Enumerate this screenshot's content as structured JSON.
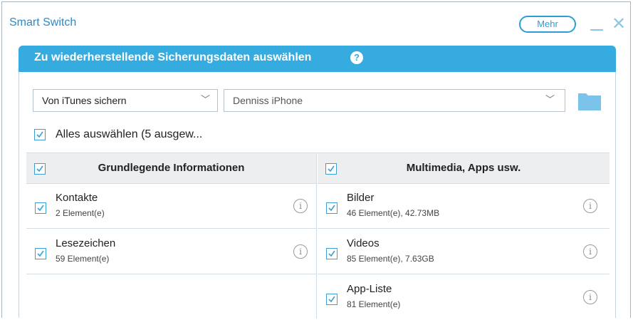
{
  "window": {
    "title": "Smart Switch",
    "more_button": "Mehr",
    "minimize_icon": "minimize-icon",
    "close_icon": "close-icon"
  },
  "panel": {
    "title": "Zu wiederherstellende Sicherungsdaten auswählen",
    "help_icon_glyph": "?"
  },
  "source_select": {
    "value": "Von iTunes sichern"
  },
  "device_select": {
    "value": "Denniss iPhone"
  },
  "select_all": {
    "label": "Alles auswählen (5 ausgew...",
    "checked": true
  },
  "columns": [
    {
      "title": "Grundlegende Informationen",
      "checked": true,
      "items": [
        {
          "name": "Kontakte",
          "count": "2 Element(e)",
          "checked": true
        },
        {
          "name": "Lesezeichen",
          "count": "59 Element(e)",
          "checked": true
        }
      ]
    },
    {
      "title": "Multimedia, Apps usw.",
      "checked": true,
      "items": [
        {
          "name": "Bilder",
          "count": "46 Element(e), 42.73MB",
          "checked": true
        },
        {
          "name": "Videos",
          "count": "85 Element(e), 7.63GB",
          "checked": true
        },
        {
          "name": "App-Liste",
          "count": "81 Element(e)",
          "checked": true
        }
      ]
    }
  ],
  "info_glyph": "i",
  "colors": {
    "accent": "#36abe0",
    "header_bg": "#eceef0",
    "checkbox": "#3a9fd8"
  }
}
